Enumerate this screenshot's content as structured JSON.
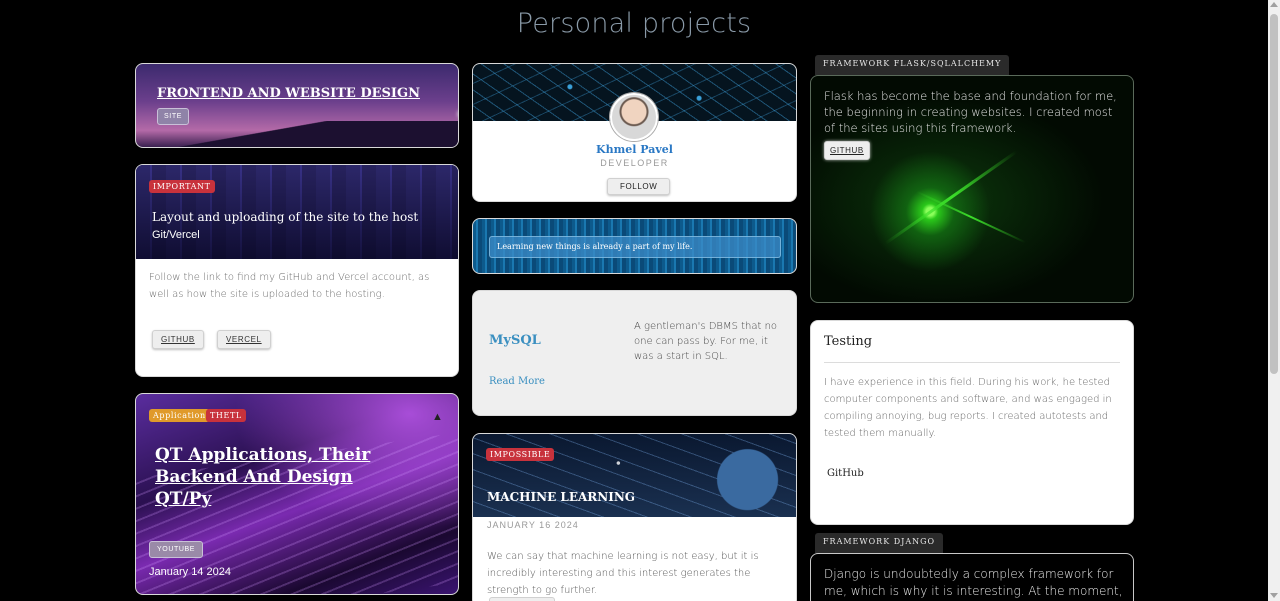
{
  "page": {
    "title": "Personal projects"
  },
  "frontend": {
    "title": "FRONTEND AND WEBSITE DESIGN",
    "button": "SITE"
  },
  "layout": {
    "badge": "IMPORTANT",
    "title": "Layout and uploading of the site to the host",
    "subtitle": "Git/Vercel",
    "description": "Follow the link to find my GitHub and Vercel account, as well as how the site is uploaded to the hosting.",
    "buttons": [
      "GITHUB",
      "VERCEL"
    ]
  },
  "qt": {
    "badges": [
      "Application",
      "THETL"
    ],
    "title_line1": "QT Applications, Their Backend And Design",
    "title_line2": "QT/Py",
    "button": "YOUTUBE",
    "date": "January 14 2024"
  },
  "profile": {
    "name": "Khmel Pavel",
    "role": "DEVELOPER",
    "button": "FOLLOW"
  },
  "quote": {
    "text": "Learning new things is already a part of my life."
  },
  "mysql": {
    "title": "MySQL",
    "description": "A gentleman's DBMS that no one can pass by. For me, it was a start in SQL.",
    "link": "Read More"
  },
  "ml": {
    "badge": "IMPOSSIBLE",
    "title": "MACHINE LEARNING",
    "date": "JANUARY 16 2024",
    "description": "We can say that machine learning is not easy, but it is incredibly interesting and this interest generates the strength to go further."
  },
  "flask": {
    "tab": "FRAMEWORK FLASK/SQLALCHEMY",
    "description": "Flask has become the base and foundation for me, the beginning in creating websites. I created most of the sites using this framework.",
    "button": "GITHUB"
  },
  "testing": {
    "title": "Testing",
    "description": "I have experience in this field. During his work, he tested computer components and software, and was engaged in compiling annoying, bug reports. I created autotests and tested them manually.",
    "link": "GitHub"
  },
  "django": {
    "tab": "FRAMEWORK DJANGO",
    "description": "Django is undoubtedly a complex framework for me, which is why it is interesting. At the moment, only"
  }
}
